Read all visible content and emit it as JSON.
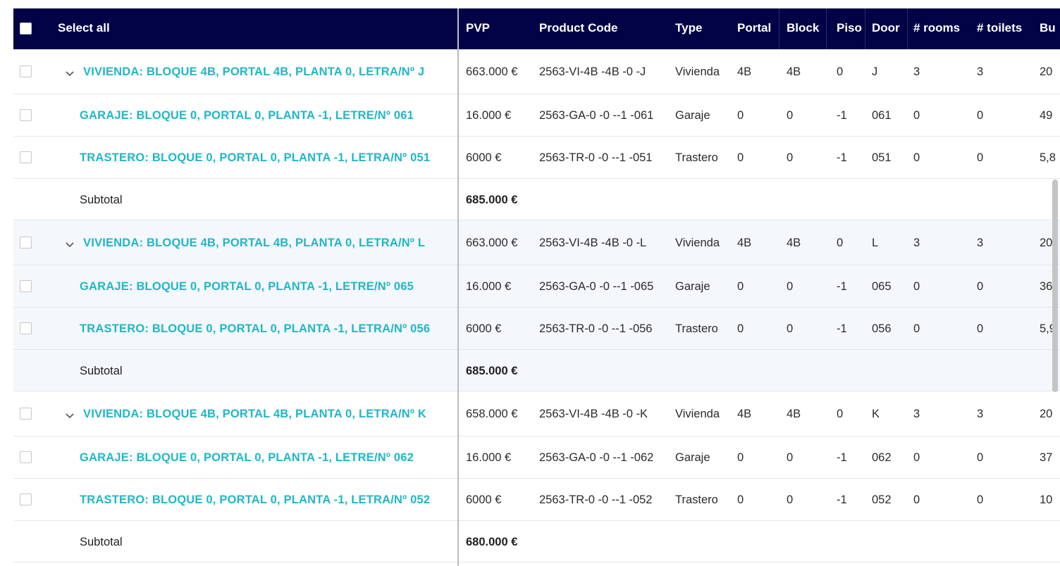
{
  "header": {
    "select_all": "Select all",
    "columns": [
      "PVP",
      "Product Code",
      "Type",
      "Portal",
      "Block",
      "Piso",
      "Door",
      "# rooms",
      "# toilets",
      "Bu"
    ]
  },
  "rows": [
    {
      "kind": "parent",
      "name": "VIVIENDA: BLOQUE 4B, PORTAL 4B, PLANTA 0, LETRA/Nº J",
      "pvp": "663.000 €",
      "code": "2563-VI-4B -4B -0 -J",
      "type": "Vivienda",
      "portal": "4B",
      "block": "4B",
      "piso": "0",
      "door": "J",
      "rooms": "3",
      "toilets": "3",
      "bu": "20"
    },
    {
      "kind": "child",
      "name": "GARAJE: BLOQUE 0, PORTAL 0, PLANTA -1, LETRE/Nº 061",
      "pvp": "16.000 €",
      "code": "2563-GA-0 -0 --1 -061",
      "type": "Garaje",
      "portal": "0",
      "block": "0",
      "piso": "-1",
      "door": "061",
      "rooms": "0",
      "toilets": "0",
      "bu": "49"
    },
    {
      "kind": "child",
      "name": "TRASTERO: BLOQUE 0, PORTAL 0, PLANTA -1, LETRA/Nº 051",
      "pvp": "6000 €",
      "code": "2563-TR-0 -0 --1 -051",
      "type": "Trastero",
      "portal": "0",
      "block": "0",
      "piso": "-1",
      "door": "051",
      "rooms": "0",
      "toilets": "0",
      "bu": "5,8"
    },
    {
      "kind": "subtotal",
      "label": "Subtotal",
      "value": "685.000 €"
    },
    {
      "kind": "parent",
      "name": "VIVIENDA: BLOQUE 4B, PORTAL 4B, PLANTA 0, LETRA/Nº L",
      "pvp": "663.000 €",
      "code": "2563-VI-4B -4B -0 -L",
      "type": "Vivienda",
      "portal": "4B",
      "block": "4B",
      "piso": "0",
      "door": "L",
      "rooms": "3",
      "toilets": "3",
      "bu": "20"
    },
    {
      "kind": "child",
      "name": "GARAJE: BLOQUE 0, PORTAL 0, PLANTA -1, LETRE/Nº 065",
      "pvp": "16.000 €",
      "code": "2563-GA-0 -0 --1 -065",
      "type": "Garaje",
      "portal": "0",
      "block": "0",
      "piso": "-1",
      "door": "065",
      "rooms": "0",
      "toilets": "0",
      "bu": "36"
    },
    {
      "kind": "child",
      "name": "TRASTERO: BLOQUE 0, PORTAL 0, PLANTA -1, LETRA/Nº 056",
      "pvp": "6000 €",
      "code": "2563-TR-0 -0 --1 -056",
      "type": "Trastero",
      "portal": "0",
      "block": "0",
      "piso": "-1",
      "door": "056",
      "rooms": "0",
      "toilets": "0",
      "bu": "5,9"
    },
    {
      "kind": "subtotal",
      "label": "Subtotal",
      "value": "685.000 €"
    },
    {
      "kind": "parent",
      "name": "VIVIENDA: BLOQUE 4B, PORTAL 4B, PLANTA 0, LETRA/Nº K",
      "pvp": "658.000 €",
      "code": "2563-VI-4B -4B -0 -K",
      "type": "Vivienda",
      "portal": "4B",
      "block": "4B",
      "piso": "0",
      "door": "K",
      "rooms": "3",
      "toilets": "3",
      "bu": "20"
    },
    {
      "kind": "child",
      "name": "GARAJE: BLOQUE 0, PORTAL 0, PLANTA -1, LETRE/Nº 062",
      "pvp": "16.000 €",
      "code": "2563-GA-0 -0 --1 -062",
      "type": "Garaje",
      "portal": "0",
      "block": "0",
      "piso": "-1",
      "door": "062",
      "rooms": "0",
      "toilets": "0",
      "bu": "37"
    },
    {
      "kind": "child",
      "name": "TRASTERO: BLOQUE 0, PORTAL 0, PLANTA -1, LETRA/Nº 052",
      "pvp": "6000 €",
      "code": "2563-TR-0 -0 --1 -052",
      "type": "Trastero",
      "portal": "0",
      "block": "0",
      "piso": "-1",
      "door": "052",
      "rooms": "0",
      "toilets": "0",
      "bu": "10"
    },
    {
      "kind": "subtotal",
      "label": "Subtotal",
      "value": "680.000 €"
    }
  ]
}
